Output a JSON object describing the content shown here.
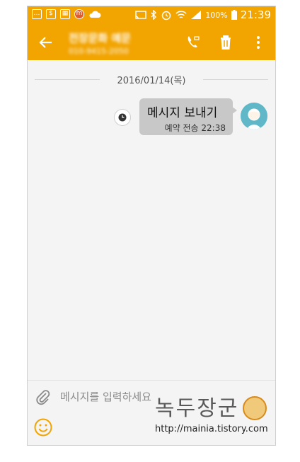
{
  "status_bar": {
    "battery_percent": "100%",
    "time": "21:39"
  },
  "app_bar": {
    "contact_name": "전장문화 예문",
    "contact_number": "010-9415-2050"
  },
  "conversation": {
    "date": "2016/01/14(목)",
    "messages": [
      {
        "text": "메시지 보내기",
        "meta": "예약 전송 22:38"
      }
    ]
  },
  "composer": {
    "placeholder": "메시지를 입력하세요"
  },
  "watermark": {
    "title": "녹두장군",
    "url": "http://mainia.tistory.com"
  },
  "colors": {
    "accent": "#f2a400",
    "bubble": "#c8c8c8",
    "emoji_icon": "#f2a400"
  }
}
